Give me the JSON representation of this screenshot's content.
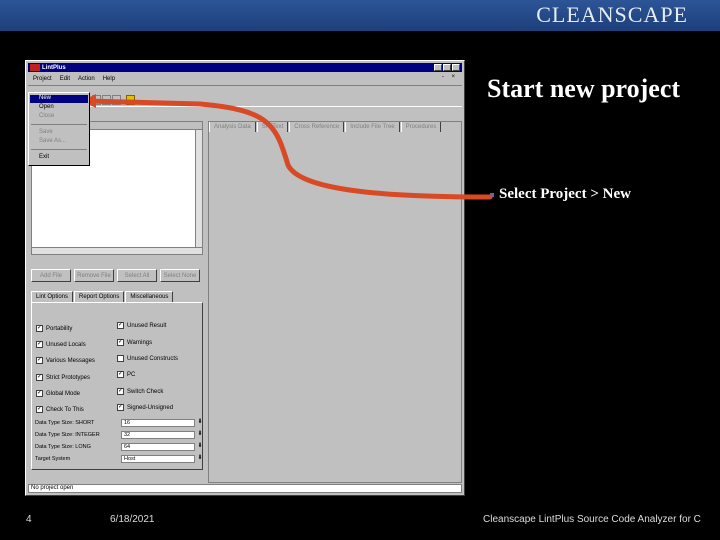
{
  "brand": "CLEANSCAPE",
  "slide": {
    "title": "Start new project",
    "bullet": "Select Project > New"
  },
  "footer": {
    "page": "4",
    "date": "6/18/2021",
    "caption": "Cleanscape LintPlus Source Code Analyzer for C"
  },
  "colors": {
    "arrow": "#d84a25",
    "topbar": "#2c5597",
    "titlebar": "#000080"
  },
  "app": {
    "title": "LintPlus",
    "menu": [
      "Project",
      "Edit",
      "Action",
      "Help"
    ],
    "file_menu": [
      "New",
      "Open",
      "Close",
      "Save",
      "Save As...",
      "Exit"
    ],
    "buttons": [
      "Add File",
      "Remove File",
      "Select All",
      "Select None"
    ],
    "left_tabs": [
      "Lint Options",
      "Report Options",
      "Miscellaneous"
    ],
    "right_tabs": [
      "Analysis Data",
      "Src Text",
      "Cross Reference",
      "Include File Tree",
      "Procedures"
    ],
    "checks_left": [
      {
        "label": "Portability",
        "checked": true
      },
      {
        "label": "Unused Locals",
        "checked": true
      },
      {
        "label": "Various Messages",
        "checked": true
      },
      {
        "label": "Strict Prototypes",
        "checked": true
      },
      {
        "label": "Global Mode",
        "checked": true
      },
      {
        "label": "Check To This",
        "checked": true
      }
    ],
    "checks_right": [
      {
        "label": "Unused Result",
        "checked": true
      },
      {
        "label": "Warnings",
        "checked": true
      },
      {
        "label": "Unused Constructs",
        "checked": false
      },
      {
        "label": "PC",
        "checked": true
      },
      {
        "label": "Switch Check",
        "checked": true
      },
      {
        "label": "Signed-Unsigned",
        "checked": true
      }
    ],
    "fields": [
      {
        "label": "Data Type Size: SHORT",
        "value": "16"
      },
      {
        "label": "Data Type Size: INTEGER",
        "value": "32"
      },
      {
        "label": "Data Type Size: LONG",
        "value": "64"
      },
      {
        "label": "Target System",
        "value": "Host"
      }
    ],
    "status": "No project open"
  }
}
